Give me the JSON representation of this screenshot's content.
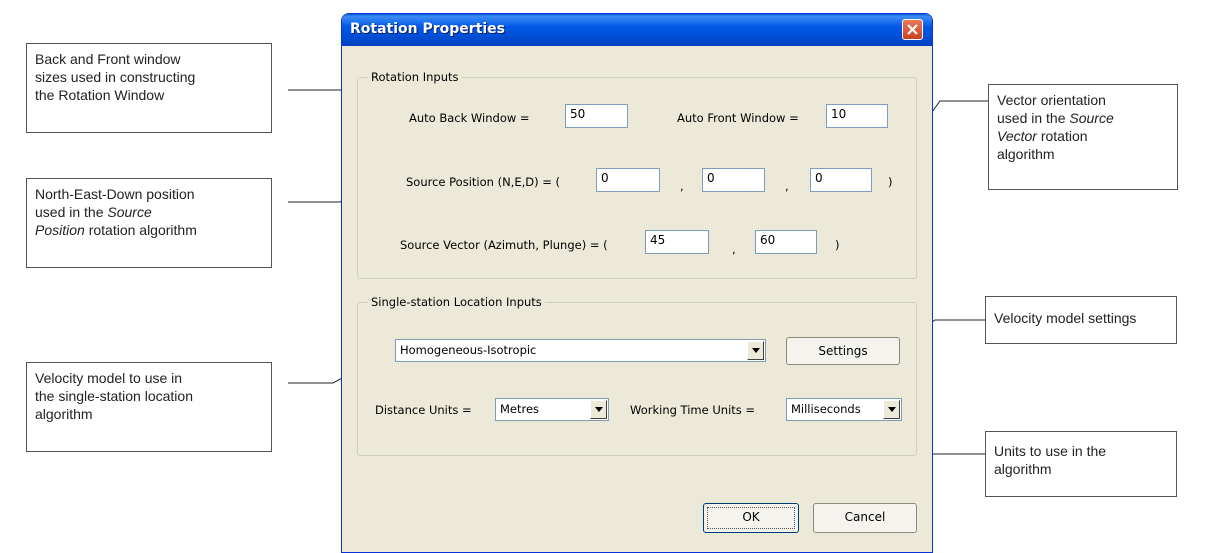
{
  "dialog": {
    "title": "Rotation Properties",
    "rotation_inputs": {
      "legend": "Rotation Inputs",
      "auto_back_label": "Auto Back Window =",
      "auto_back_value": "50",
      "auto_front_label": "Auto Front Window =",
      "auto_front_value": "10",
      "source_position_label": "Source Position (N,E,D) = (",
      "source_position_n": "0",
      "source_position_e": "0",
      "source_position_d": "0",
      "comma": ",",
      "close_paren": ")",
      "source_vector_label": "Source Vector (Azimuth, Plunge) = (",
      "azimuth": "45",
      "plunge": "60"
    },
    "single_station": {
      "legend": "Single-station Location Inputs",
      "velocity_model": "Homogeneous-Isotropic",
      "settings_button": "Settings",
      "distance_units_label": "Distance Units =",
      "distance_units": "Metres",
      "working_time_label": "Working Time Units =",
      "working_time_units": "Milliseconds"
    },
    "ok_button": "OK",
    "cancel_button": "Cancel"
  },
  "callouts": {
    "windows": [
      "Back and Front window",
      "sizes used in constructing",
      "the Rotation Window"
    ],
    "position": {
      "line1": "North-East-Down position",
      "line2_pre": "used in the ",
      "line2_em": "Source",
      "line3_em": "Position",
      "line3_post": " rotation algorithm"
    },
    "velocity_use": [
      "Velocity model to use in",
      "the single-station location",
      "algorithm"
    ],
    "vector": {
      "line1": "Vector orientation",
      "line2": "used in the ",
      "line2_em": "Source",
      "line3_em": "Vector",
      "line3_post": " rotation",
      "line4": "algorithm"
    },
    "velocity_settings": "Velocity model settings",
    "units": [
      "Units to use in the",
      "algorithm"
    ]
  },
  "colors": {
    "titlebar": "#0058e6",
    "dialog_bg": "#ece9d8",
    "close_button": "#c8401c"
  }
}
